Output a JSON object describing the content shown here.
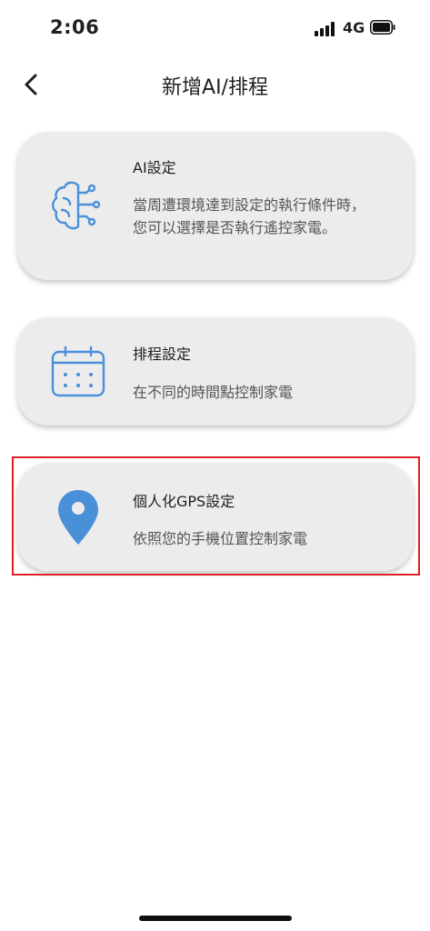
{
  "status": {
    "time": "2:06",
    "network": "4G"
  },
  "header": {
    "title": "新增AI/排程",
    "back_icon": "chevron-left-icon"
  },
  "cards": [
    {
      "title": "AI設定",
      "desc1": "當周遭環境達到設定的執行條件時，",
      "desc2": "您可以選擇是否執行遙控家電。",
      "icon": "brain-icon"
    },
    {
      "title": "排程設定",
      "desc": "在不同的時間點控制家電",
      "icon": "calendar-icon"
    },
    {
      "title": "個人化GPS設定",
      "desc": "依照您的手機位置控制家電",
      "icon": "location-pin-icon"
    }
  ],
  "colors": {
    "accent": "#4a90d9",
    "card_bg": "#ececec",
    "highlight": "#e01e26"
  }
}
